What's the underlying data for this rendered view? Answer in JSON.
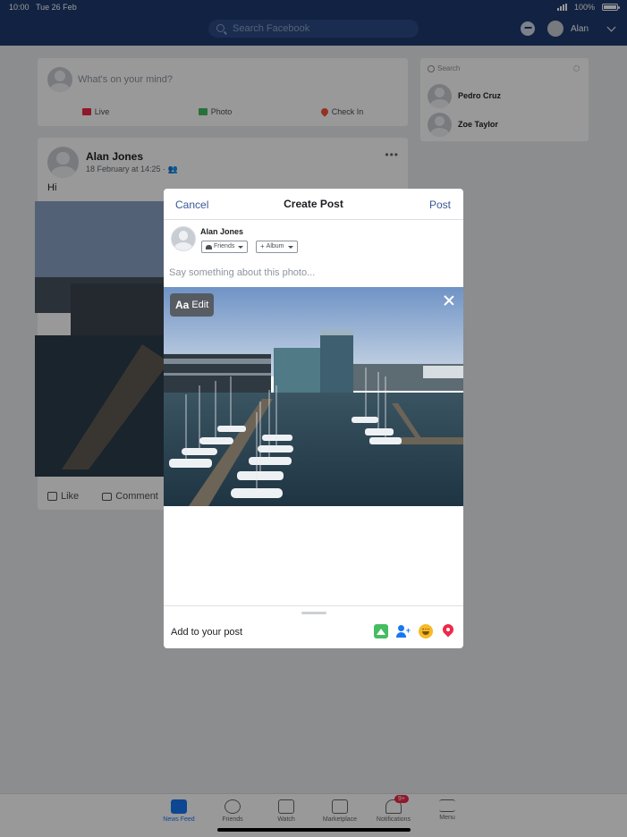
{
  "status": {
    "time": "10:00",
    "date": "Tue 26 Feb",
    "battery": "100%",
    "battery_level": 1.0
  },
  "nav": {
    "search_placeholder": "Search Facebook",
    "user_name": "Alan"
  },
  "composer": {
    "placeholder": "What's on your mind?",
    "actions": [
      "Live",
      "Photo",
      "Check In"
    ]
  },
  "post": {
    "author": "Alan Jones",
    "meta": "18 February at 14:25 ·",
    "text": "Hi",
    "more": "•••",
    "actions": [
      "Like",
      "Comment"
    ]
  },
  "contacts": {
    "search_placeholder": "Search",
    "people": [
      "Pedro Cruz",
      "Zoe Taylor"
    ]
  },
  "modal": {
    "cancel": "Cancel",
    "title": "Create Post",
    "post": "Post",
    "author": "Alan Jones",
    "audience": "Friends",
    "album": "Album",
    "caption_placeholder": "Say something about this photo...",
    "edit_aa": "Aa",
    "edit_label": "Edit",
    "add_to_post": "Add to your post"
  },
  "tabbar": {
    "tabs": [
      "News Feed",
      "Friends",
      "Watch",
      "Marketplace",
      "Notifications",
      "Menu"
    ],
    "notification_badge": "9+"
  },
  "colors": {
    "nav_bg": "#1f3a6e",
    "link_blue": "#385898",
    "photo_green": "#45bd62",
    "tag_blue": "#1877f2",
    "feeling_yellow": "#f7b928",
    "location_red": "#f02849"
  }
}
